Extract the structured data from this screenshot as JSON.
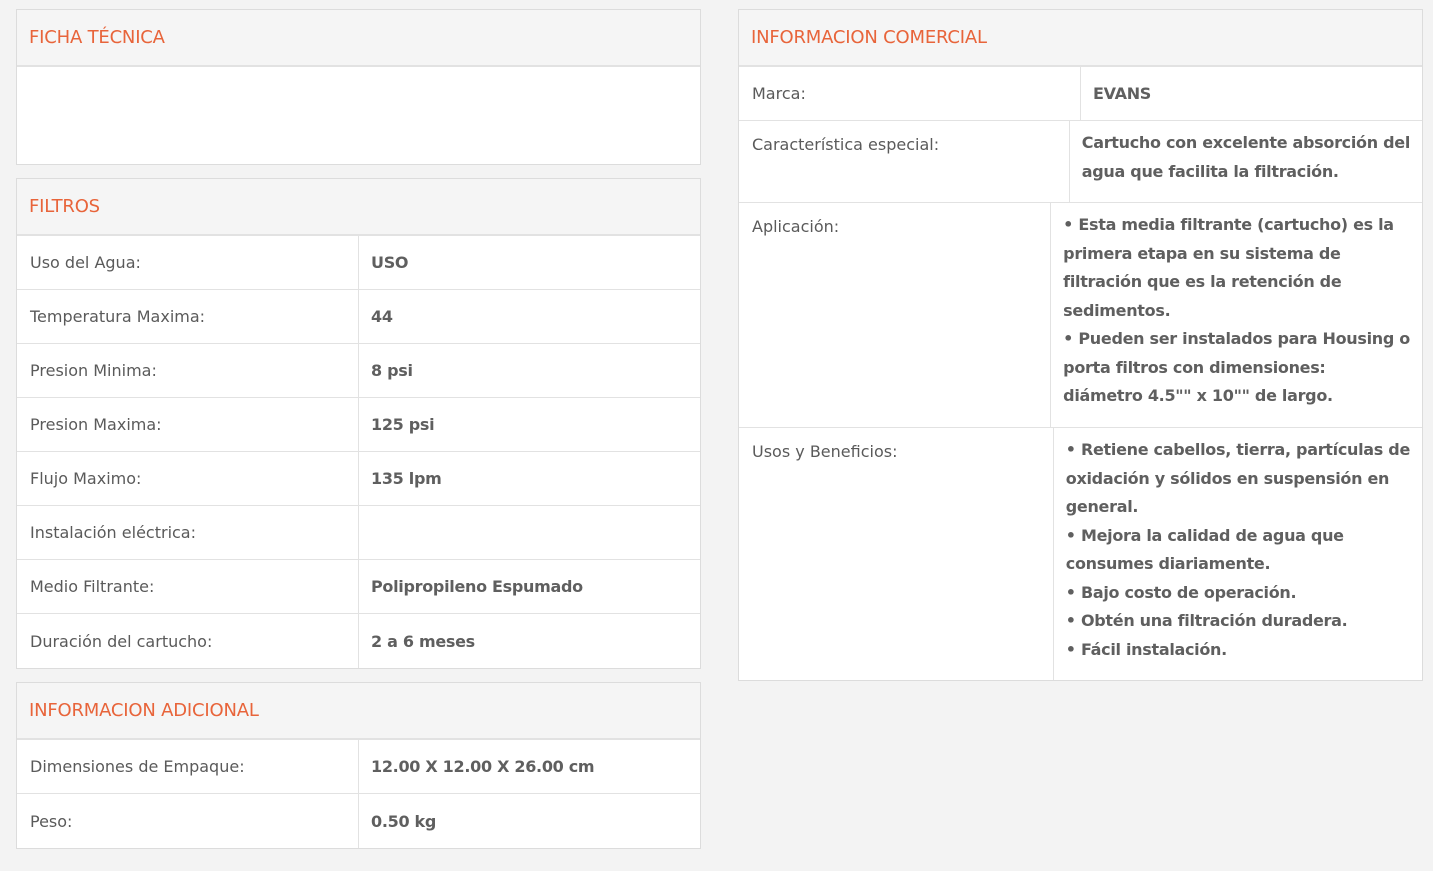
{
  "ficha": {
    "title": "FICHA TÉCNICA"
  },
  "filtros": {
    "title": "FILTROS",
    "rows": [
      {
        "label": "Uso del Agua:",
        "value": "USO"
      },
      {
        "label": "Temperatura Maxima:",
        "value": "44"
      },
      {
        "label": "Presion Minima:",
        "value": "8 psi"
      },
      {
        "label": "Presion Maxima:",
        "value": "125 psi"
      },
      {
        "label": "Flujo Maximo:",
        "value": "135 lpm"
      },
      {
        "label": "Instalación eléctrica:",
        "value": ""
      },
      {
        "label": "Medio Filtrante:",
        "value": "Polipropileno Espumado"
      },
      {
        "label": "Duración del cartucho:",
        "value": "2 a 6 meses"
      }
    ]
  },
  "adicional": {
    "title": "INFORMACION ADICIONAL",
    "rows": [
      {
        "label": "Dimensiones de Empaque:",
        "value": "12.00 X 12.00 X 26.00 cm"
      },
      {
        "label": "Peso:",
        "value": "0.50 kg"
      }
    ]
  },
  "comercial": {
    "title": "INFORMACION COMERCIAL",
    "marca": {
      "label": "Marca:",
      "value": "EVANS"
    },
    "caracteristica": {
      "label": "Característica especial:",
      "lines": [
        "Cartucho con excelente absorción del",
        "agua que facilita la filtración."
      ]
    },
    "aplicacion": {
      "label": "Aplicación:",
      "lines": [
        "• Esta media filtrante (cartucho) es la",
        "primera etapa en su sistema de",
        "filtración que es la retención de",
        "sedimentos.",
        "• Pueden ser instalados para Housing o",
        "porta filtros con dimensiones:",
        "diámetro 4.5\"\" x 10\"\" de largo."
      ]
    },
    "usos": {
      "label": "Usos y Beneficios:",
      "lines": [
        "• Retiene cabellos, tierra, partículas de",
        "oxidación y sólidos en suspensión en",
        "general.",
        "• Mejora la calidad de agua que",
        "consumes diariamente.",
        "• Bajo costo de operación.",
        "• Obtén una filtración duradera.",
        "• Fácil instalación."
      ]
    }
  },
  "colors": {
    "accent": "#e8643a",
    "border": "#e2e2e2",
    "header_bg": "#f5f5f5"
  }
}
